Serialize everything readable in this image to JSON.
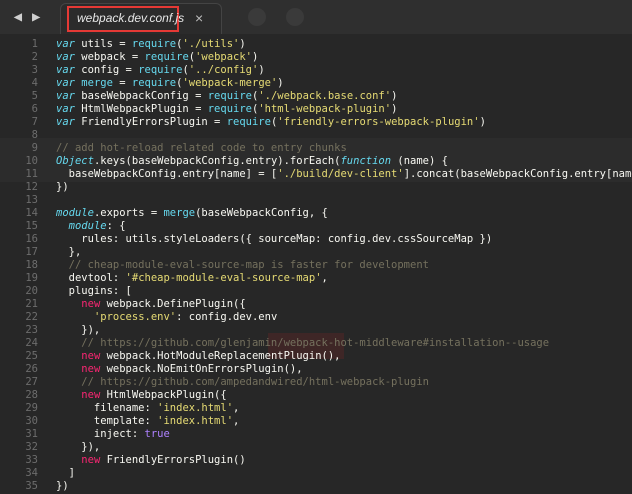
{
  "tab": {
    "title": "webpack.dev.conf.js",
    "close": "×"
  },
  "nav": {
    "back": "◀",
    "forward": "▶"
  },
  "lines": [
    {
      "n": "1",
      "t": "var utils = require('./utils')"
    },
    {
      "n": "2",
      "t": "var webpack = require('webpack')"
    },
    {
      "n": "3",
      "t": "var config = require('../config')"
    },
    {
      "n": "4",
      "t": "var merge = require('webpack-merge')"
    },
    {
      "n": "5",
      "t": "var baseWebpackConfig = require('./webpack.base.conf')"
    },
    {
      "n": "6",
      "t": "var HtmlWebpackPlugin = require('html-webpack-plugin')"
    },
    {
      "n": "7",
      "t": "var FriendlyErrorsPlugin = require('friendly-errors-webpack-plugin')"
    },
    {
      "n": "8",
      "t": ""
    },
    {
      "n": "9",
      "t": "// add hot-reload related code to entry chunks"
    },
    {
      "n": "10",
      "t": "Object.keys(baseWebpackConfig.entry).forEach(function (name) {"
    },
    {
      "n": "11",
      "t": "  baseWebpackConfig.entry[name] = ['./build/dev-client'].concat(baseWebpackConfig.entry[name])"
    },
    {
      "n": "12",
      "t": "})"
    },
    {
      "n": "13",
      "t": ""
    },
    {
      "n": "14",
      "t": "module.exports = merge(baseWebpackConfig, {"
    },
    {
      "n": "15",
      "t": "  module: {"
    },
    {
      "n": "16",
      "t": "    rules: utils.styleLoaders({ sourceMap: config.dev.cssSourceMap })"
    },
    {
      "n": "17",
      "t": "  },"
    },
    {
      "n": "18",
      "t": "  // cheap-module-eval-source-map is faster for development"
    },
    {
      "n": "19",
      "t": "  devtool: '#cheap-module-eval-source-map',"
    },
    {
      "n": "20",
      "t": "  plugins: ["
    },
    {
      "n": "21",
      "t": "    new webpack.DefinePlugin({"
    },
    {
      "n": "22",
      "t": "      'process.env': config.dev.env"
    },
    {
      "n": "23",
      "t": "    }),"
    },
    {
      "n": "24",
      "t": "    // https://github.com/glenjamin/webpack-hot-middleware#installation--usage"
    },
    {
      "n": "25",
      "t": "    new webpack.HotModuleReplacementPlugin(),"
    },
    {
      "n": "26",
      "t": "    new webpack.NoEmitOnErrorsPlugin(),"
    },
    {
      "n": "27",
      "t": "    // https://github.com/ampedandwired/html-webpack-plugin"
    },
    {
      "n": "28",
      "t": "    new HtmlWebpackPlugin({"
    },
    {
      "n": "29",
      "t": "      filename: 'index.html',"
    },
    {
      "n": "30",
      "t": "      template: 'index.html',"
    },
    {
      "n": "31",
      "t": "      inject: true"
    },
    {
      "n": "32",
      "t": "    }),"
    },
    {
      "n": "33",
      "t": "    new FriendlyErrorsPlugin()"
    },
    {
      "n": "34",
      "t": "  ]"
    },
    {
      "n": "35",
      "t": "})"
    }
  ]
}
